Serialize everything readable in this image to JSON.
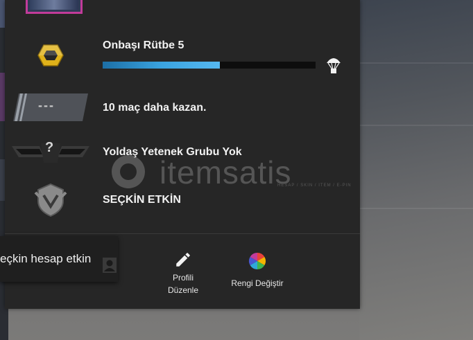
{
  "profile_card": {
    "rank": {
      "label": "Onbaşı Rütbe 5",
      "progress": 0.55
    },
    "wins": {
      "label": "10 maç daha kazan.",
      "placeholder_text": "---"
    },
    "wingman": {
      "label": "Yoldaş Yetenek Grubu Yok",
      "badge_text": "?"
    },
    "prime": {
      "label": "SEÇKİN ETKİN"
    }
  },
  "tooltip": {
    "text": "eçkin hesap etkin"
  },
  "actions": [
    {
      "label": "Profil",
      "icon": "profile-icon"
    },
    {
      "label": "Profili Düzenle",
      "line1": "Profili",
      "line2": "Düzenle",
      "icon": "pencil-icon"
    },
    {
      "label": "Rengi Değiştir",
      "icon": "color-wheel-icon"
    }
  ],
  "watermark": {
    "brand": "itemsatis",
    "tagline": "HESAP / SKIN / ITEM / E-PIN",
    "suffix": ".com"
  },
  "colors": {
    "panel_bg": "#262626",
    "progress_fill": "#3aa3e0",
    "avatar_border": "#c23b9a",
    "rank_gold": "#e0b21a"
  }
}
